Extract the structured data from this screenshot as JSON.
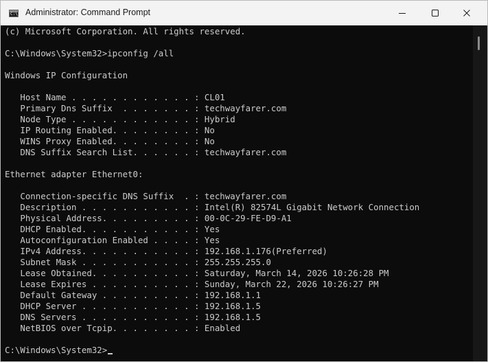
{
  "window": {
    "title": "Administrator: Command Prompt",
    "icon": "cmd-icon",
    "icon_prompt": "C:\\_"
  },
  "controls": {
    "minimize": "minimize-icon",
    "maximize": "maximize-icon",
    "close": "close-icon"
  },
  "console": {
    "lines": [
      "(c) Microsoft Corporation. All rights reserved.",
      "",
      "C:\\Windows\\System32>ipconfig /all",
      "",
      "Windows IP Configuration",
      "",
      "   Host Name . . . . . . . . . . . . : CL01",
      "   Primary Dns Suffix  . . . . . . . : techwayfarer.com",
      "   Node Type . . . . . . . . . . . . : Hybrid",
      "   IP Routing Enabled. . . . . . . . : No",
      "   WINS Proxy Enabled. . . . . . . . : No",
      "   DNS Suffix Search List. . . . . . : techwayfarer.com",
      "",
      "Ethernet adapter Ethernet0:",
      "",
      "   Connection-specific DNS Suffix  . : techwayfarer.com",
      "   Description . . . . . . . . . . . : Intel(R) 82574L Gigabit Network Connection",
      "   Physical Address. . . . . . . . . : 00-0C-29-FE-D9-A1",
      "   DHCP Enabled. . . . . . . . . . . : Yes",
      "   Autoconfiguration Enabled . . . . : Yes",
      "   IPv4 Address. . . . . . . . . . . : 192.168.1.176(Preferred)",
      "   Subnet Mask . . . . . . . . . . . : 255.255.255.0",
      "   Lease Obtained. . . . . . . . . . : Saturday, March 14, 2026 10:26:28 PM",
      "   Lease Expires . . . . . . . . . . : Sunday, March 22, 2026 10:26:27 PM",
      "   Default Gateway . . . . . . . . . : 192.168.1.1",
      "   DHCP Server . . . . . . . . . . . : 192.168.1.5",
      "   DNS Servers . . . . . . . . . . . : 192.168.1.5",
      "   NetBIOS over Tcpip. . . . . . . . : Enabled",
      "",
      "C:\\Windows\\System32>"
    ]
  },
  "colors": {
    "console_bg": "#0c0c0c",
    "console_text": "#cccccc",
    "titlebar_bg": "#f3f3f3"
  }
}
